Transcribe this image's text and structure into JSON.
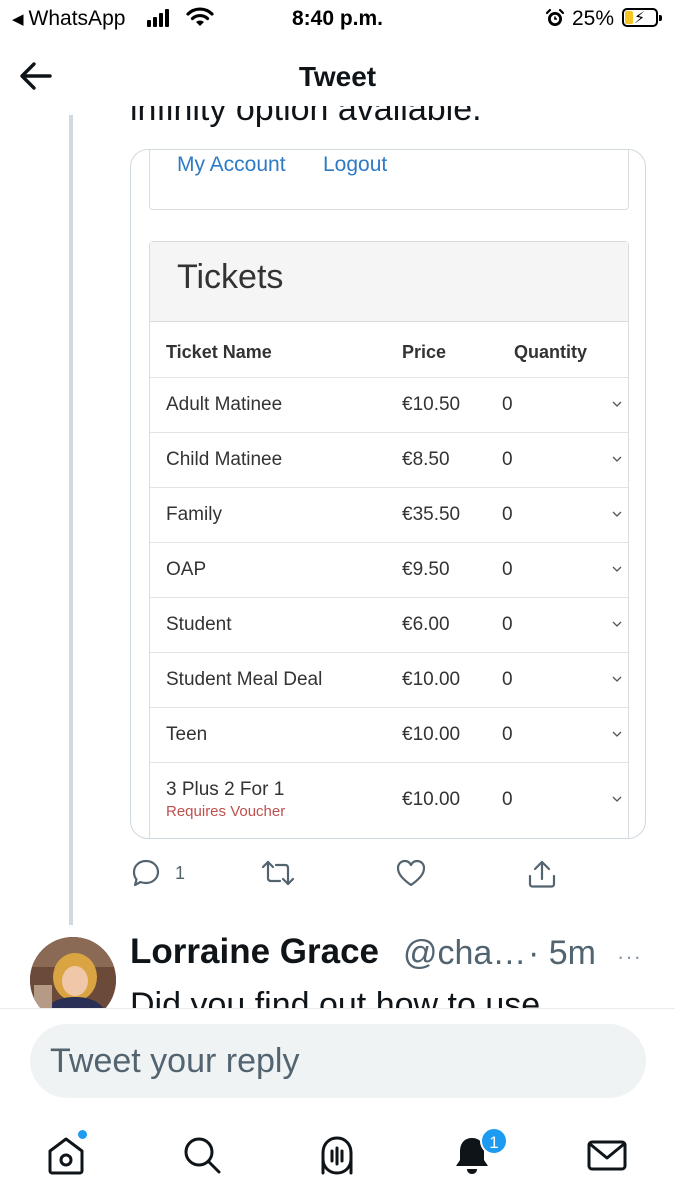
{
  "status_bar": {
    "back_app": "WhatsApp",
    "time": "8:40 p.m.",
    "battery": "25%",
    "battery_level": 0.25
  },
  "header": {
    "title": "Tweet"
  },
  "tweet": {
    "text_fragment": "infinity option available."
  },
  "embedded": {
    "account_links": [
      "My Account",
      "Logout"
    ],
    "tickets_title": "Tickets",
    "columns": {
      "name": "Ticket Name",
      "price": "Price",
      "quantity": "Quantity"
    },
    "tickets": [
      {
        "name": "Adult Matinee",
        "price": "€10.50",
        "qty": "0"
      },
      {
        "name": "Child Matinee",
        "price": "€8.50",
        "qty": "0"
      },
      {
        "name": "Family",
        "price": "€35.50",
        "qty": "0"
      },
      {
        "name": "OAP",
        "price": "€9.50",
        "qty": "0"
      },
      {
        "name": "Student",
        "price": "€6.00",
        "qty": "0"
      },
      {
        "name": "Student Meal Deal",
        "price": "€10.00",
        "qty": "0"
      },
      {
        "name": "Teen",
        "price": "€10.00",
        "qty": "0"
      },
      {
        "name": "3 Plus 2 For 1",
        "note": "Requires Voucher",
        "price": "€10.00",
        "qty": "0"
      }
    ]
  },
  "actions": {
    "reply_count": "1"
  },
  "reply": {
    "name": "Lorraine Grace",
    "handle": "@cha…",
    "time": "· 5m",
    "more": "···",
    "text_fragment": "Did you find out how to use"
  },
  "compose": {
    "placeholder": "Tweet your reply"
  },
  "tabbar": {
    "notifications_badge": "1"
  },
  "colors": {
    "link": "#2e7bc4",
    "voucher_note": "#c0504d",
    "twitter_blue": "#1d9bf0",
    "battery_fill": "#f3c623"
  }
}
